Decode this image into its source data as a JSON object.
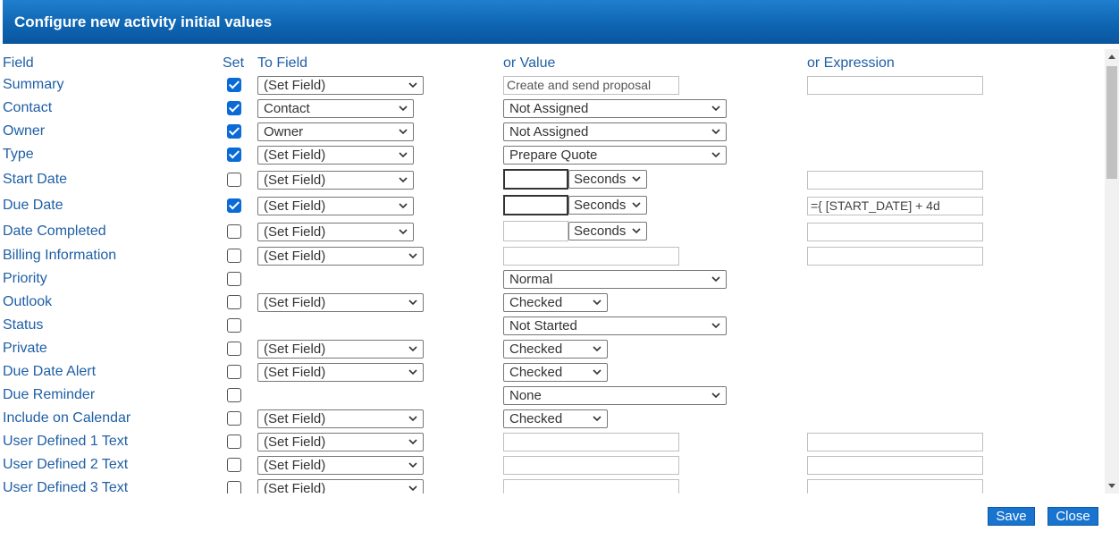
{
  "dialog": {
    "title": "Configure new activity initial values",
    "save_label": "Save",
    "close_label": "Close"
  },
  "headers": {
    "field": "Field",
    "set": "Set",
    "to_field": "To Field",
    "or_value": "or Value",
    "or_expression": "or Expression"
  },
  "rows": [
    {
      "label": "Summary",
      "set": true,
      "to_field": "(Set Field)",
      "value": "Create and send proposal",
      "expression": ""
    },
    {
      "label": "Contact",
      "set": true,
      "to_field": "Contact",
      "value": "Not Assigned"
    },
    {
      "label": "Owner",
      "set": true,
      "to_field": "Owner",
      "value": "Not Assigned"
    },
    {
      "label": "Type",
      "set": true,
      "to_field": "(Set Field)",
      "value": "Prepare Quote"
    },
    {
      "label": "Start Date",
      "set": false,
      "to_field": "(Set Field)",
      "value": "",
      "unit": "Seconds",
      "expression": ""
    },
    {
      "label": "Due Date",
      "set": true,
      "to_field": "(Set Field)",
      "value": "",
      "unit": "Seconds",
      "expression": "={ [START_DATE] + 4d"
    },
    {
      "label": "Date Completed",
      "set": false,
      "to_field": "(Set Field)",
      "value": "",
      "unit": "Seconds",
      "expression": ""
    },
    {
      "label": "Billing Information",
      "set": false,
      "to_field": "(Set Field)",
      "value": "",
      "expression": ""
    },
    {
      "label": "Priority",
      "set": false,
      "value": "Normal"
    },
    {
      "label": "Outlook",
      "set": false,
      "to_field": "(Set Field)",
      "value": "Checked"
    },
    {
      "label": "Status",
      "set": false,
      "value": "Not Started"
    },
    {
      "label": "Private",
      "set": false,
      "to_field": "(Set Field)",
      "value": "Checked"
    },
    {
      "label": "Due Date Alert",
      "set": false,
      "to_field": "(Set Field)",
      "value": "Checked"
    },
    {
      "label": "Due Reminder",
      "set": false,
      "value": "None"
    },
    {
      "label": "Include on Calendar",
      "set": false,
      "to_field": "(Set Field)",
      "value": "Checked"
    },
    {
      "label": "User Defined 1 Text",
      "set": false,
      "to_field": "(Set Field)",
      "value": "",
      "expression": ""
    },
    {
      "label": "User Defined 2 Text",
      "set": false,
      "to_field": "(Set Field)",
      "value": "",
      "expression": ""
    },
    {
      "label": "User Defined 3 Text",
      "set": false,
      "to_field": "(Set Field)",
      "value": "",
      "expression": ""
    }
  ],
  "colors": {
    "title_bar": "#0f66b3",
    "label_text": "#1f5fa5",
    "checkbox_checked": "#0a6bd6",
    "button": "#1874cf"
  },
  "icons": {
    "dropdown": "chevron-down-icon",
    "checkbox": "checkmark-icon",
    "scroll_up": "triangle-up-icon",
    "scroll_down": "triangle-down-icon"
  }
}
